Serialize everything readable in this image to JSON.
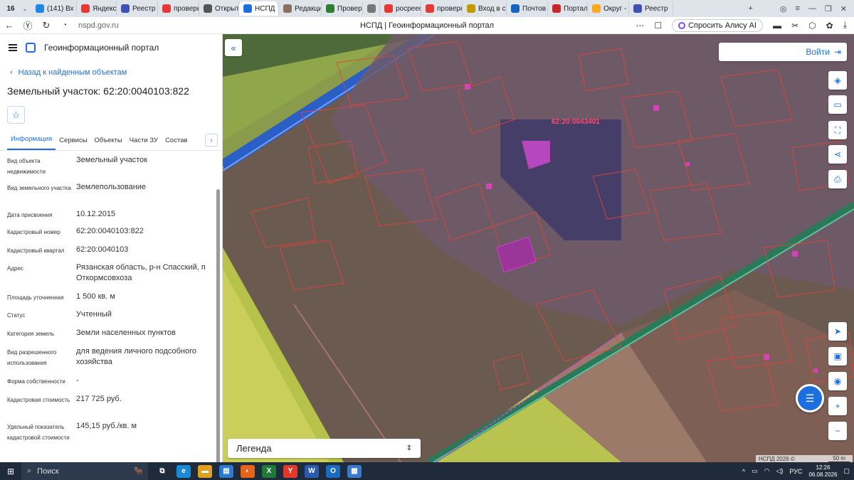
{
  "browser": {
    "tab_count": "16",
    "tabs": [
      {
        "label": "(141) Вх",
        "color": "#1e88e5"
      },
      {
        "label": "Яндекс",
        "color": "#e53935"
      },
      {
        "label": "Реестр",
        "color": "#3f51b5"
      },
      {
        "label": "проверк",
        "color": "#e53935"
      },
      {
        "label": "Открыт",
        "color": "#555555"
      },
      {
        "label": "НСПД",
        "color": "#1d6fe0",
        "active": true
      },
      {
        "label": "Редакци",
        "color": "#8d6e63"
      },
      {
        "label": "Провер",
        "color": "#2e7d32"
      },
      {
        "label": "",
        "color": "#777777"
      },
      {
        "label": "росреес",
        "color": "#e53935"
      },
      {
        "label": "проверк",
        "color": "#e53935"
      },
      {
        "label": "Вход в с",
        "color": "#c49a00"
      },
      {
        "label": "Почтов",
        "color": "#1565c0"
      },
      {
        "label": "Портал",
        "color": "#c62828"
      },
      {
        "label": "Округ -",
        "color": "#f9a825"
      },
      {
        "label": "Реестр",
        "color": "#3f51b5"
      }
    ],
    "url": "nspd.gov.ru",
    "page_title": "НСПД | Геоинформационный портал",
    "alice_label": "Спросить Алису AI"
  },
  "sidebar": {
    "portal_title": "Геоинформационный портал",
    "back_link": "Назад к найденным объектам",
    "object_title": "Земельный участок: 62:20:0040103:822",
    "tabs": [
      "Информация",
      "Сервисы",
      "Объекты",
      "Части ЗУ",
      "Состав"
    ],
    "properties": [
      {
        "key": "Вид объекта недвижимости",
        "value": "Земельный участок"
      },
      {
        "key": "Вид земельного участка",
        "value": "Землепользование"
      },
      {
        "key": "Дата присвоения",
        "value": "10.12.2015"
      },
      {
        "key": "Кадастровый номер",
        "value": "62:20:0040103:822"
      },
      {
        "key": "Кадастровый квартал",
        "value": "62:20:0040103"
      },
      {
        "key": "Адрес",
        "value": "Рязанская область, р-н Спасский, п Откормсовхоза"
      },
      {
        "key": "Площадь уточненная",
        "value": "1 500 кв. м"
      },
      {
        "key": "Статус",
        "value": "Учтенный"
      },
      {
        "key": "Категория земель",
        "value": "Земли населенных пунктов"
      },
      {
        "key": "Вид разрешенного использования",
        "value": "для ведения личного подсобного хозяйства"
      },
      {
        "key": "Форма собственности",
        "value": "-"
      },
      {
        "key": "Кадастровая стоимость",
        "value": "217 725 руб."
      },
      {
        "key": "Удельный показатель кадастровой стоимости",
        "value": "145,15 руб./кв. м"
      }
    ]
  },
  "map": {
    "login_label": "Войти",
    "cad_label": "62:20:0043401",
    "legend_label": "Легенда",
    "attribution": "НСПД 2026 ©",
    "scale": "50 m"
  },
  "taskbar": {
    "search_label": "Поиск",
    "lang": "РУС",
    "time": "12:26",
    "date": "06.08.2026"
  }
}
